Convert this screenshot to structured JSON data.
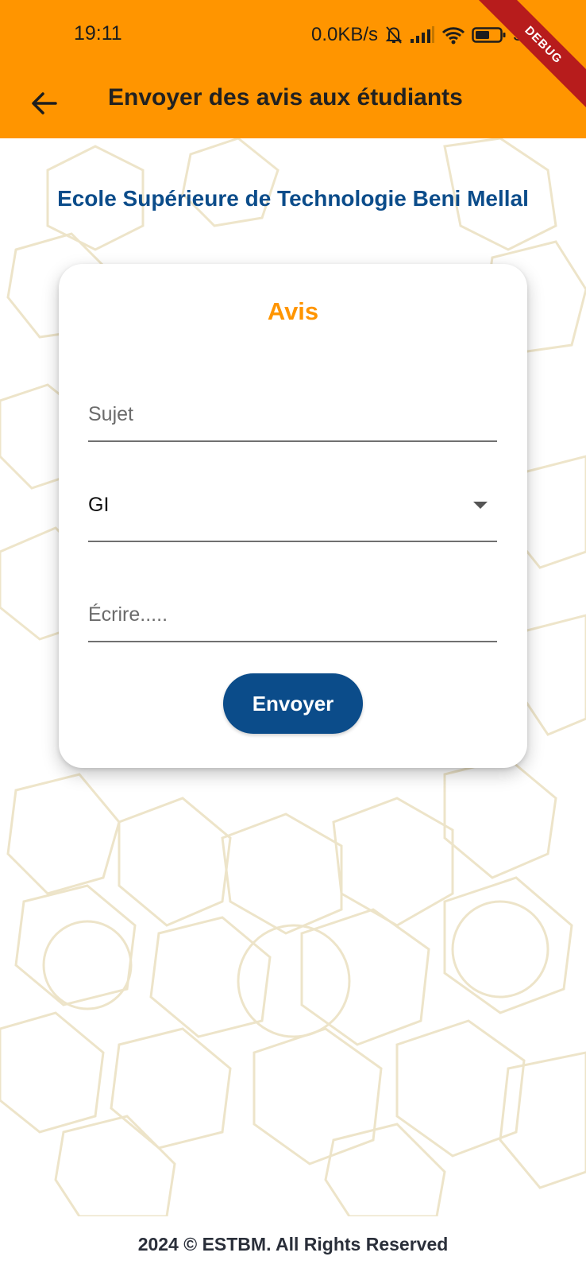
{
  "status_bar": {
    "time": "19:11",
    "speed": "0.0KB/s",
    "battery": "50"
  },
  "debug_banner": "DEBUG",
  "app_bar": {
    "title": "Envoyer des avis aux étudiants"
  },
  "school_name": "Ecole Supérieure de Technologie Beni Mellal",
  "form": {
    "title": "Avis",
    "subject_placeholder": "Sujet",
    "subject_value": "",
    "group_selected": "GI",
    "message_placeholder": "Écrire.....",
    "message_value": "",
    "submit_label": "Envoyer"
  },
  "footer": "2024 © ESTBM. All Rights Reserved",
  "colors": {
    "app_bar": "#ff9500",
    "primary_blue": "#0b4c8a",
    "accent_orange": "#ff9500",
    "pattern": "#e8dcb8"
  }
}
